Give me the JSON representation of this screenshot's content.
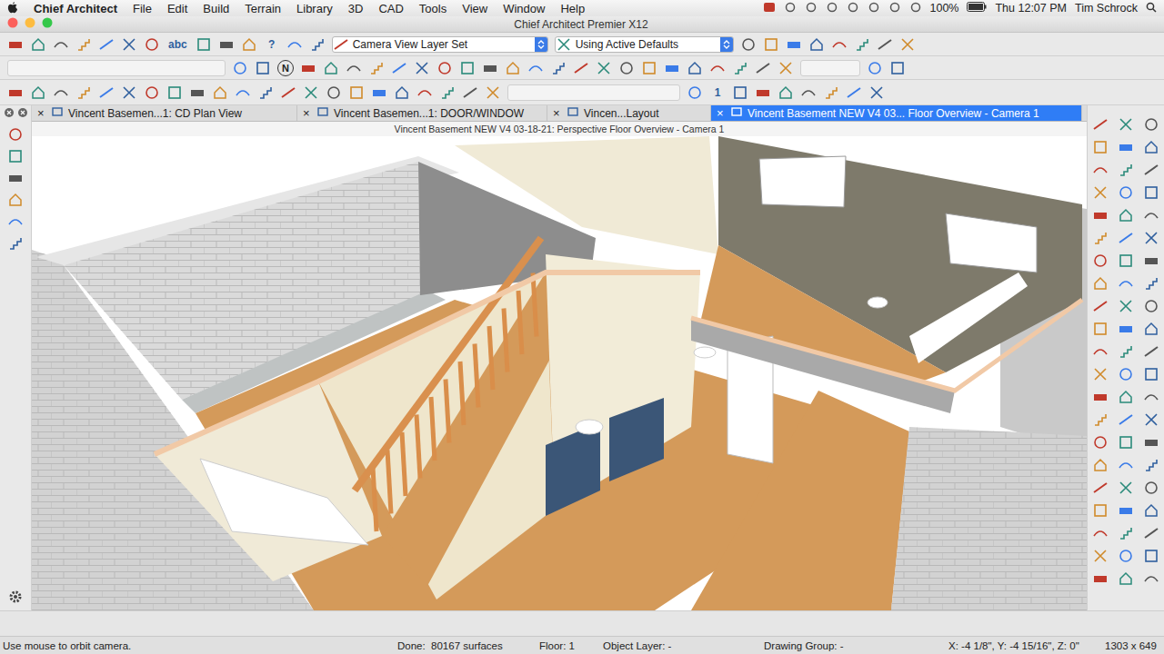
{
  "menu_bar": {
    "app": "Chief Architect",
    "items": [
      "File",
      "Edit",
      "Build",
      "Terrain",
      "Library",
      "3D",
      "CAD",
      "Tools",
      "View",
      "Window",
      "Help"
    ],
    "battery": "100%",
    "clock": "Thu 12:07 PM",
    "user": "Tim Schrock"
  },
  "window": {
    "title": "Chief Architect Premier X12"
  },
  "toolbar": {
    "spell_check": "abc",
    "help": "?",
    "layer_set": "Camera View Layer Set",
    "defaults": "Using Active Defaults",
    "north": "N",
    "floor_number": "1"
  },
  "tabs": [
    {
      "label": "Vincent Basemen...1: CD Plan View",
      "close": "×",
      "selected": false
    },
    {
      "label": "Vincent Basemen...1:  DOOR/WINDOW",
      "close": "×",
      "selected": false
    },
    {
      "label": "Vincen...Layout",
      "close": "×",
      "selected": false
    },
    {
      "label": "Vincent Basement NEW V4 03... Floor Overview - Camera 1",
      "close": "×",
      "selected": true
    }
  ],
  "view_title": "Vincent Basement NEW V4 03-18-21: Perspective Floor Overview - Camera 1",
  "status_bar": {
    "hint": "Use mouse to orbit camera.",
    "progress": "Done:  80167 surfaces",
    "floor": "Floor: 1",
    "object_layer": "Object Layer: -",
    "drawing_group": "Drawing Group: -",
    "coords": "X: -4 1/8\", Y: -4 15/16\", Z: 0\"",
    "size": "1303 x 649"
  }
}
